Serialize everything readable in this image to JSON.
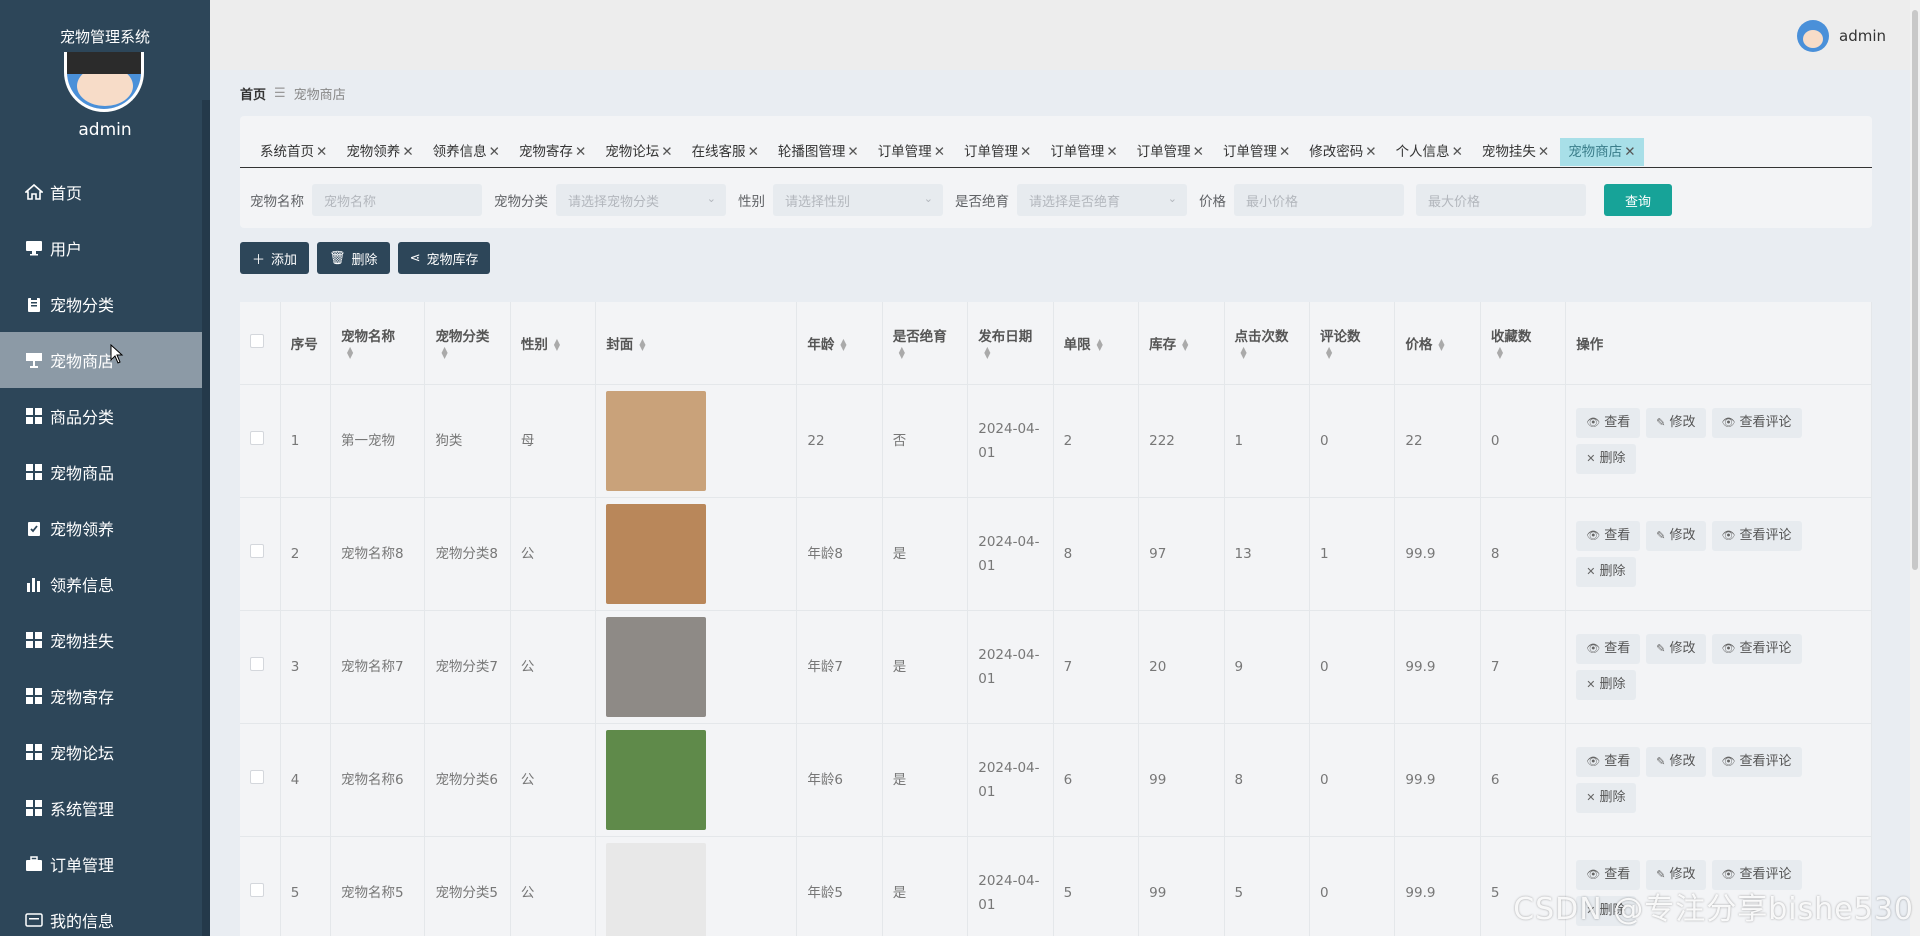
{
  "sidebar": {
    "title": "宠物管理系统",
    "user": "admin",
    "items": [
      {
        "label": "首页",
        "icon": "home-icon"
      },
      {
        "label": "用户",
        "icon": "monitor-icon"
      },
      {
        "label": "宠物分类",
        "icon": "clipboard-icon"
      },
      {
        "label": "宠物商店",
        "icon": "shop-icon",
        "active": true
      },
      {
        "label": "商品分类",
        "icon": "grid-icon"
      },
      {
        "label": "宠物商品",
        "icon": "grid-icon"
      },
      {
        "label": "宠物领养",
        "icon": "clipboard-check-icon"
      },
      {
        "label": "领养信息",
        "icon": "bar-chart-icon"
      },
      {
        "label": "宠物挂失",
        "icon": "grid-icon"
      },
      {
        "label": "宠物寄存",
        "icon": "grid-icon"
      },
      {
        "label": "宠物论坛",
        "icon": "grid-icon"
      },
      {
        "label": "系统管理",
        "icon": "grid-icon"
      },
      {
        "label": "订单管理",
        "icon": "briefcase-icon"
      },
      {
        "label": "我的信息",
        "icon": "id-card-icon"
      }
    ]
  },
  "topbar": {
    "user": "admin"
  },
  "breadcrumb": {
    "home": "首页",
    "current": "宠物商店"
  },
  "tabs": [
    "系统首页",
    "宠物领养",
    "领养信息",
    "宠物寄存",
    "宠物论坛",
    "在线客服",
    "轮播图管理",
    "订单管理",
    "订单管理",
    "订单管理",
    "订单管理",
    "订单管理",
    "修改密码",
    "个人信息",
    "宠物挂失",
    "宠物商店"
  ],
  "filters": {
    "name_label": "宠物名称",
    "name_placeholder": "宠物名称",
    "category_label": "宠物分类",
    "category_placeholder": "请选择宠物分类",
    "gender_label": "性别",
    "gender_placeholder": "请选择性别",
    "sterilized_label": "是否绝育",
    "sterilized_placeholder": "请选择是否绝育",
    "price_label": "价格",
    "min_price_placeholder": "最小价格",
    "max_price_placeholder": "最大价格",
    "search_button": "查询"
  },
  "actions": {
    "add": "添加",
    "delete": "删除",
    "stock": "宠物库存"
  },
  "table": {
    "headers": {
      "index": "序号",
      "name": "宠物名称",
      "category": "宠物分类",
      "gender": "性别",
      "cover": "封面",
      "age": "年龄",
      "sterilized": "是否绝育",
      "date": "发布日期",
      "limit": "单限",
      "stock": "库存",
      "clicks": "点击次数",
      "comments": "评论数",
      "price": "价格",
      "favorites": "收藏数",
      "ops": "操作"
    },
    "ops": {
      "view": "查看",
      "edit": "修改",
      "view_comments": "查看评论",
      "delete": "删除"
    },
    "rows": [
      {
        "index": "1",
        "name": "第一宠物",
        "category": "狗类",
        "gender": "母",
        "age": "22",
        "sterilized": "否",
        "date": "2024-04-01",
        "limit": "2",
        "stock": "222",
        "clicks": "1",
        "comments": "0",
        "price": "22",
        "favorites": "0",
        "cover_color": "#c9a27a"
      },
      {
        "index": "2",
        "name": "宠物名称8",
        "category": "宠物分类8",
        "gender": "公",
        "age": "年龄8",
        "sterilized": "是",
        "date": "2024-04-01",
        "limit": "8",
        "stock": "97",
        "clicks": "13",
        "comments": "1",
        "price": "99.9",
        "favorites": "8",
        "cover_color": "#b9875a"
      },
      {
        "index": "3",
        "name": "宠物名称7",
        "category": "宠物分类7",
        "gender": "公",
        "age": "年龄7",
        "sterilized": "是",
        "date": "2024-04-01",
        "limit": "7",
        "stock": "20",
        "clicks": "9",
        "comments": "0",
        "price": "99.9",
        "favorites": "7",
        "cover_color": "#8e8a86"
      },
      {
        "index": "4",
        "name": "宠物名称6",
        "category": "宠物分类6",
        "gender": "公",
        "age": "年龄6",
        "sterilized": "是",
        "date": "2024-04-01",
        "limit": "6",
        "stock": "99",
        "clicks": "8",
        "comments": "0",
        "price": "99.9",
        "favorites": "6",
        "cover_color": "#5f8a4a"
      },
      {
        "index": "5",
        "name": "宠物名称5",
        "category": "宠物分类5",
        "gender": "公",
        "age": "年龄5",
        "sterilized": "是",
        "date": "2024-04-01",
        "limit": "5",
        "stock": "99",
        "clicks": "5",
        "comments": "0",
        "price": "99.9",
        "favorites": "5",
        "cover_color": "#e8e8e8"
      }
    ]
  },
  "watermark": "CSDN @专注分享bishe530",
  "colors": {
    "sidebar": "#2d4659",
    "accent": "#17a398",
    "active_tab": "#a8dfe8"
  }
}
